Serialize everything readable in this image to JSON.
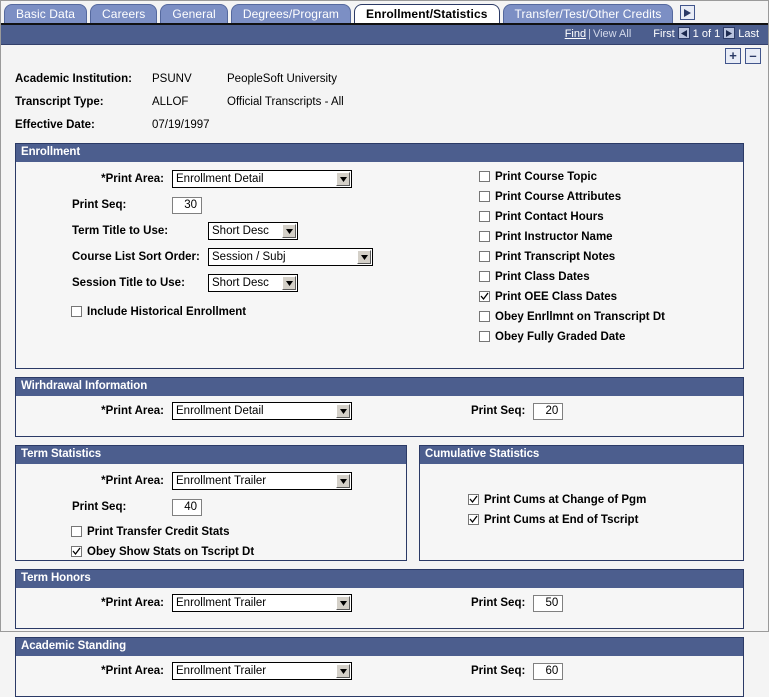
{
  "tabs": [
    {
      "label": "Basic Data",
      "active": false
    },
    {
      "label": "Careers",
      "active": false
    },
    {
      "label": "General",
      "active": false
    },
    {
      "label": "Degrees/Program",
      "active": false
    },
    {
      "label": "Enrollment/Statistics",
      "active": true
    },
    {
      "label": "Transfer/Test/Other Credits",
      "active": false
    }
  ],
  "tab_next_icon": "next-arrow-icon",
  "navbar": {
    "find": "Find",
    "separator": "|",
    "view_all": "View All",
    "first": "First",
    "counter": "1 of 1",
    "last": "Last",
    "prev_icon": "prev-arrow-icon",
    "next_icon": "next-arrow-icon"
  },
  "rowbuttons": {
    "add": "+",
    "remove": "–"
  },
  "keyfields": [
    {
      "label": "Academic Institution:",
      "code": "PSUNV",
      "desc": "PeopleSoft University"
    },
    {
      "label": "Transcript Type:",
      "code": "ALLOF",
      "desc": "Official Transcripts - All"
    },
    {
      "label": "Effective Date:",
      "code": "07/19/1997",
      "desc": ""
    }
  ],
  "enrollment": {
    "title": "Enrollment",
    "print_area_label": "*Print Area:",
    "print_area_value": "Enrollment Detail",
    "print_seq_label": "Print Seq:",
    "print_seq_value": "30",
    "term_title_label": "Term Title to Use:",
    "term_title_value": "Short Desc",
    "course_sort_label": "Course List Sort Order:",
    "course_sort_value": "Session / Subj",
    "session_title_label": "Session Title to Use:",
    "session_title_value": "Short Desc",
    "include_historical_label": "Include Historical Enrollment",
    "include_historical_checked": false,
    "options": [
      {
        "label": "Print Course Topic",
        "checked": false
      },
      {
        "label": "Print Course Attributes",
        "checked": false
      },
      {
        "label": "Print Contact Hours",
        "checked": false
      },
      {
        "label": "Print Instructor Name",
        "checked": false
      },
      {
        "label": "Print Transcript Notes",
        "checked": false
      },
      {
        "label": "Print Class Dates",
        "checked": false
      },
      {
        "label": "Print OEE Class Dates",
        "checked": true
      },
      {
        "label": "Obey Enrllmnt on Transcript Dt",
        "checked": false
      },
      {
        "label": "Obey Fully Graded Date",
        "checked": false
      }
    ]
  },
  "withdrawal": {
    "title": "Wirhdrawal Information",
    "print_area_label": "*Print Area:",
    "print_area_value": "Enrollment Detail",
    "print_seq_label": "Print Seq:",
    "print_seq_value": "20"
  },
  "term_statistics": {
    "title": "Term Statistics",
    "print_area_label": "*Print Area:",
    "print_area_value": "Enrollment Trailer",
    "print_seq_label": "Print Seq:",
    "print_seq_value": "40",
    "options": [
      {
        "label": "Print Transfer Credit Stats",
        "checked": false
      },
      {
        "label": "Obey Show Stats on Tscript Dt",
        "checked": true
      }
    ]
  },
  "cumulative_statistics": {
    "title": "Cumulative Statistics",
    "options": [
      {
        "label": "Print Cums at Change of Pgm",
        "checked": true
      },
      {
        "label": "Print Cums at End of Tscript",
        "checked": true
      }
    ]
  },
  "term_honors": {
    "title": "Term Honors",
    "print_area_label": "*Print Area:",
    "print_area_value": "Enrollment Trailer",
    "print_seq_label": "Print Seq:",
    "print_seq_value": "50"
  },
  "academic_standing": {
    "title": "Academic Standing",
    "print_area_label": "*Print Area:",
    "print_area_value": "Enrollment Trailer",
    "print_seq_label": "Print Seq:",
    "print_seq_value": "60"
  },
  "colors": {
    "header_blue": "#4c5e8e",
    "tab_blue": "#7c8fc4",
    "border_blue": "#2b3a66",
    "page_bg": "#f4f4f4"
  }
}
